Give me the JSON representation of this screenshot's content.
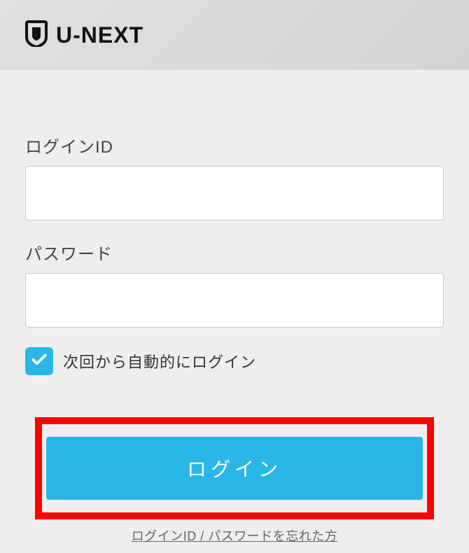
{
  "header": {
    "brand": "U-NEXT"
  },
  "form": {
    "login_id_label": "ログインID",
    "password_label": "パスワード",
    "auto_login_label": "次回から自動的にログイン",
    "auto_login_checked": true,
    "login_button": "ログイン",
    "forgot_link": "ログインID / パスワードを忘れた方"
  },
  "colors": {
    "accent": "#29b7e5",
    "highlight_border": "#ff0000"
  }
}
